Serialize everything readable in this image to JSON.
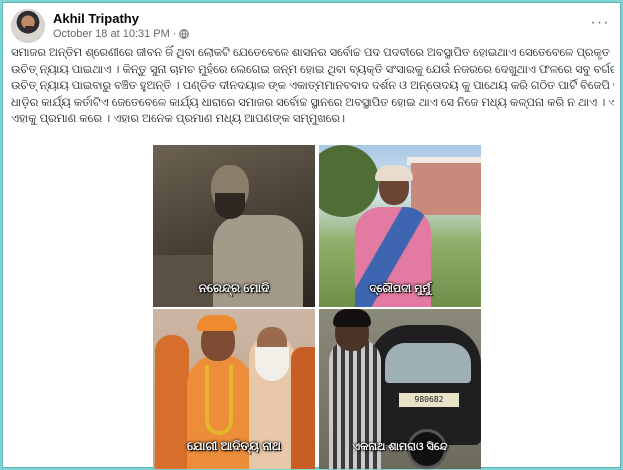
{
  "post": {
    "author": "Akhil Tripathy",
    "timestamp": "October 18 at 10:31 PM",
    "separator": "·",
    "audience_icon": "globe-icon",
    "more_icon": "more-options-icon",
    "more_label": "···",
    "text_lines": [
      "ସମାଜର ଅନ୍ତିମ ଶ୍ରେଣୀରେ ଜୀବନ ଜିଁ ଥିବା ଲୋକଟି ଯେତେବେଳେ ଶାସନର ସର୍ବୋଚ୍ଚ ପଦ ପଦବୀରେ ଅବସ୍ଥାପିତ ହୋଇଥାଏ ସେତେବେଳେ ପ୍ରକୃତ",
      "ଉଚିତ୍ ନ୍ୟାୟ ପାଇଥାଏ । କିନ୍ତୁ ସୁନା ଚାମଚ ମୁହଁରେ ଲେଗେଇ ଜନ୍ମ ହୋଇ ଥିବା ବ୍ୟକ୍ତି ସଂସାରକୁ ଯେଉଁ ନଜରରେ ଦେଖୁଥାଏ ଫଳରେ ସବୁ ବର୍ଗର ଲୋକ",
      "ଉଚିତ୍ ନ୍ୟାୟ ପାଇବାରୁ ବଞ୍ଚିତ ହୁଅନ୍ତି । ପଣ୍ଡିତ ଦୀନଦୟାଳ ଙ୍କ ଏକାତ୍ମମାନବବାଦ ଦର୍ଶନ ଓ ଅନ୍ତୋଦୟ କୁ ପାଥେୟ କରି ଗଠିତ ପାର୍ଟି ବିଜେପି ତାର ଅନ୍ତିମ",
      "ଧାଡ଼ିର କାର୍ଯ୍ୟ କର୍ତାଟିଏ ଜେତେବେଳେ କାର୍ଯ୍ୟ ଧାରାରେ ସମାଜର ସର୍ବୋଚ୍ଚ ସ୍ଥାନରେ ଅବସ୍ଥାପିତ ହୋଇ ଥାଏ ସେ ନିଜେ ମଧ୍ୟ କଳ୍ପନା କରି ନ ଥାଏ । ଏ ଚିତ୍ର",
      "ଏହାକୁ ପ୍ରମାଣ କରେ । ଏହାର ଅନେକ ପ୍ରମାଣ ମଧ୍ୟ ଆପଣଙ୍କ ସମ୍ମୁଖରେ।"
    ]
  },
  "collage": {
    "captions": [
      "ନରେନ୍ଦ୍ର ମୋଦି",
      "ଦ୍ରୌପଦୀ ମୁର୍ମୁ",
      "ଯୋଗୀ ଆଦିତ୍ୟ ନାଥ",
      "ଏକନାଥ ଶାମରାଓ ସିନ୍ଦେ"
    ],
    "auto_plate": "9806B2"
  },
  "colors": {
    "background": "#7fd3d3",
    "author_text": "#050505",
    "meta_text": "#65676b"
  }
}
